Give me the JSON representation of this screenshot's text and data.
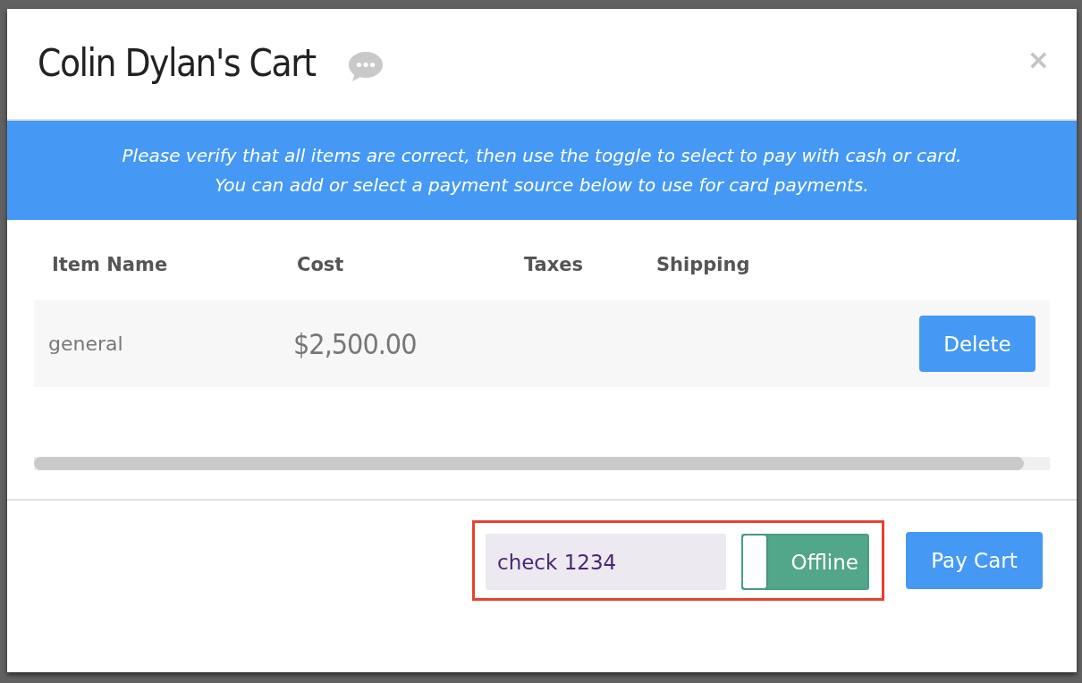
{
  "dialog": {
    "title": "Colin Dylan's Cart",
    "close": "×"
  },
  "banner": {
    "lines": [
      "Please verify that all items are correct, then use the toggle to select to pay with cash or card.",
      "You can add or select a payment source below to use for card payments."
    ]
  },
  "table": {
    "columns": [
      "Item Name",
      "Cost",
      "Taxes",
      "Shipping"
    ],
    "rows": [
      {
        "item_name": "general",
        "cost": "$2,500.00",
        "action": "Delete"
      }
    ]
  },
  "footer": {
    "payment_controls": {
      "highlighted": true,
      "reference_field": {
        "value": "check 1234"
      },
      "payment_toggle": {
        "label": "Offline",
        "on": false
      }
    },
    "pay_button": "Pay Cart"
  }
}
